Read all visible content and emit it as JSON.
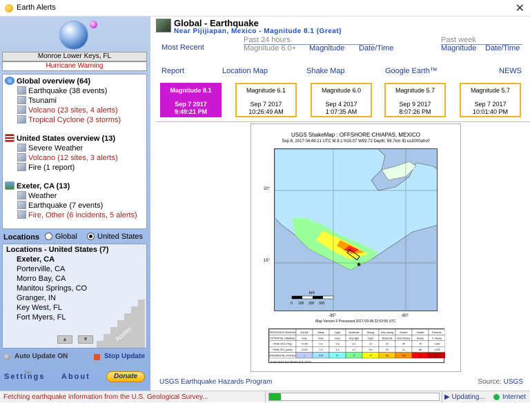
{
  "window": {
    "title": "Earth Alerts",
    "close_glyph": "✕"
  },
  "location": {
    "name": "Monroe Lower Keys, FL",
    "warning": "Hurricane Warning"
  },
  "sections": {
    "global": {
      "title": "Global overview (64)",
      "items": [
        "Earthquake (38 events)",
        "Tsunami",
        "Volcano (23 sites, 4 alerts)",
        "Tropical Cyclone (3 storms)"
      ]
    },
    "us": {
      "title": "United States overview (13)",
      "items": [
        "Severe Weather",
        "Volcano (12 sites, 3 alerts)",
        "Fire (1 report)"
      ]
    },
    "local": {
      "title": "Exeter, CA (13)",
      "items": [
        "Weather",
        "Earthquake (7 events)",
        "Fire, Other (6 incidents, 5 alerts)"
      ]
    }
  },
  "locations": {
    "label": "Locations",
    "radio_global": "Global",
    "radio_us": "United States",
    "selected": "United States",
    "list_title": "Locations - United States (7)",
    "items": [
      "Exeter, CA",
      "Porterville, CA",
      "Morro Bay, CA",
      "Manitou Springs, CO",
      "Granger, IN",
      "Key West, FL",
      "Fort Myers, FL"
    ],
    "selected_item": "Exeter, CA",
    "watermark": "Apples Software Group"
  },
  "controls": {
    "auto_update": "Auto Update ON",
    "stop_update": "Stop Update",
    "settings": "Settings",
    "about": "About",
    "donate": "Donate"
  },
  "header": {
    "title": "Global - Earthquake",
    "subtitle": "Near Pijijiapan, Mexico - Magnitude 8.1 (Great)",
    "most_recent": "Most Recent",
    "past24": "Past 24 hours",
    "mag_60": "Magnitude 6.0+",
    "magnitude": "Magnitude",
    "datetime": "Date/Time",
    "past_week": "Past week",
    "magnitude2": "Magnitude",
    "datetime2": "Date/Time"
  },
  "links": {
    "report": "Report",
    "location_map": "Location Map",
    "shake_map": "Shake Map",
    "google_earth": "Google Earth™",
    "news": "NEWS"
  },
  "quakes": [
    {
      "mag": "Magnitude 8.1",
      "date": "Sep 7 2017",
      "time": "9:49:21 PM"
    },
    {
      "mag": "Magnitude 6.1",
      "date": "Sep 7 2017",
      "time": "10:26:49 AM"
    },
    {
      "mag": "Magnitude 6.0",
      "date": "Sep 4 2017",
      "time": "1:07:35 AM"
    },
    {
      "mag": "Magnitude 5.7",
      "date": "Sep 9 2017",
      "time": "8:07:26 PM"
    },
    {
      "mag": "Magnitude 5.7",
      "date": "Sep 7 2017",
      "time": "10:01:40 PM"
    }
  ],
  "shakemap": {
    "title": "USGS ShakeMap : OFFSHORE CHIAPAS, MEXICO",
    "subtitle": "Sep 8, 2017 04:49:21 UTC  M 8.1  N15.07 W93.72  Depth: 69.7km  ID:us2000ahv0",
    "lat_20": "20°",
    "lat_15": "15°",
    "lon_95": "-95°",
    "lon_90": "-90°",
    "scale_title": "km",
    "scale_ticks": [
      "0",
      "100",
      "200",
      "300"
    ],
    "version": "Map Version 6 Processed 2017-09-08 22:03:55 UTC",
    "legend_rows": [
      [
        "PERCEIVED SHAKING",
        "Not felt",
        "Weak",
        "Light",
        "Moderate",
        "Strong",
        "Very strong",
        "Severe",
        "Violent",
        "Extreme"
      ],
      [
        "POTENTIAL DAMAGE",
        "none",
        "none",
        "none",
        "Very light",
        "Light",
        "Moderate",
        "Mod./Heavy",
        "Heavy",
        "V. Heavy"
      ],
      [
        "PEAK ACC.(%g)",
        "<0.05",
        "0.3",
        "2.8",
        "6.2",
        "12",
        "22",
        "40",
        "75",
        ">139"
      ],
      [
        "PEAK VEL.(cm/s)",
        "<0.02",
        "0.1",
        "1.4",
        "4.7",
        "9.6",
        "20",
        "41",
        "86",
        ">178"
      ],
      [
        "INSTRUMENTAL INTENSITY",
        "I",
        "II-III",
        "IV",
        "V",
        "VI",
        "VII",
        "VIII",
        "IX",
        "X+"
      ]
    ],
    "legend_note": "Scale based upon Worden et al. (2012)",
    "legend_colors": [
      "#ffffff",
      "#bfccff",
      "#a0e6ff",
      "#80ffff",
      "#7aff93",
      "#ffff00",
      "#ffc800",
      "#ff9100",
      "#ff0000",
      "#c80000"
    ]
  },
  "footer": {
    "left": "USGS Earthquake Hazards Program",
    "right_label": "Source:",
    "right_link": "USGS"
  },
  "status": {
    "message": "Fetching earthquake information from the U.S. Geological Survey...",
    "progress": 0.07,
    "updating": "Updating...",
    "internet": "Internet"
  },
  "colors": {
    "selected_quake": "#cc18d0",
    "quake_border": "#e8b82a",
    "alert_red": "#a8201e",
    "link_blue": "#1e3c96"
  }
}
